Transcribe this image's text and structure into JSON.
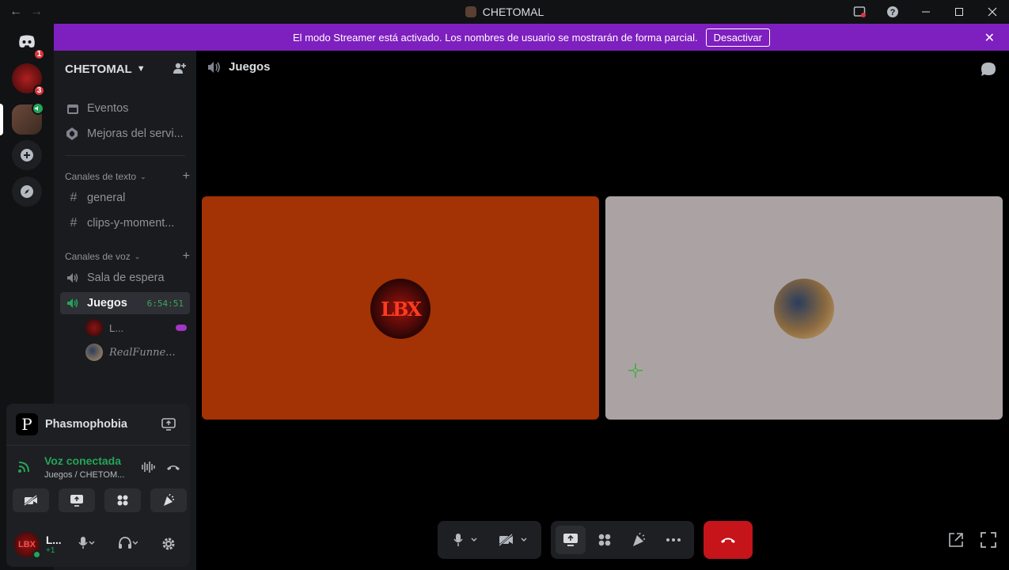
{
  "titlebar": {
    "title": "CHETOMAL",
    "back": "←",
    "forward": "→"
  },
  "rail": {
    "dm_badge": "1",
    "server1_badge": "3"
  },
  "banner": {
    "text": "El modo Streamer está activado. Los nombres de usuario se mostrarán de forma parcial.",
    "button": "Desactivar",
    "color": "#7e1fbf"
  },
  "sidebar": {
    "server_name": "CHETOMAL",
    "items": [
      {
        "label": "Eventos",
        "icon": "calendar-icon"
      },
      {
        "label": "Mejoras del servi...",
        "icon": "boost-icon"
      }
    ],
    "text_category": "Canales de texto",
    "text_channels": [
      "general",
      "clips-y-moment..."
    ],
    "voice_category": "Canales de voz",
    "voice_channels": [
      {
        "label": "Sala de espera"
      },
      {
        "label": "Juegos",
        "timer": "6:54:51",
        "active": true
      }
    ],
    "voice_users": [
      {
        "name": "L..."
      },
      {
        "name": "RealFunne..."
      }
    ]
  },
  "activity": {
    "game": "Phasmophobia",
    "game_initial": "P",
    "voice_title": "Voz conectada",
    "voice_sub": "Juegos / CHETOM..."
  },
  "user": {
    "name": "L...",
    "status": "+1",
    "avatar_text": "LBX"
  },
  "main": {
    "channel": "Juegos",
    "tile1_avatar_text": "LBX",
    "tile1_color": "#a33204",
    "tile2_color": "#aba3a3",
    "hangup_color": "#c5141a",
    "accent_green": "#23a559"
  }
}
